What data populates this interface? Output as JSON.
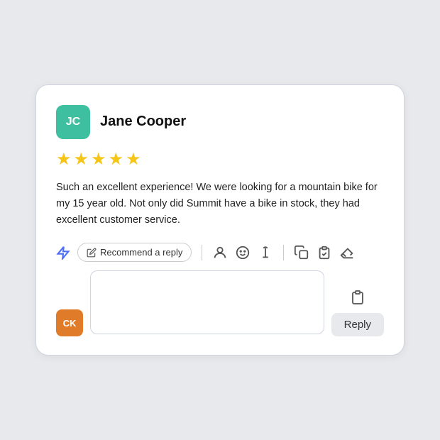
{
  "card": {
    "user": {
      "initials": "JC",
      "name": "Jane Cooper",
      "avatar_bg": "#3dbfa0"
    },
    "stars": 5,
    "star_char": "★",
    "review_text": "Such an excellent experience! We were looking for a mountain bike for my 15 year old. Not only did Summit have a bike in stock, they had excellent customer service.",
    "toolbar": {
      "recommend_label": "Recommend a reply"
    },
    "reply": {
      "avatar_initials": "CK",
      "avatar_bg": "#e07b2a",
      "placeholder": "",
      "reply_button_label": "Reply"
    }
  }
}
